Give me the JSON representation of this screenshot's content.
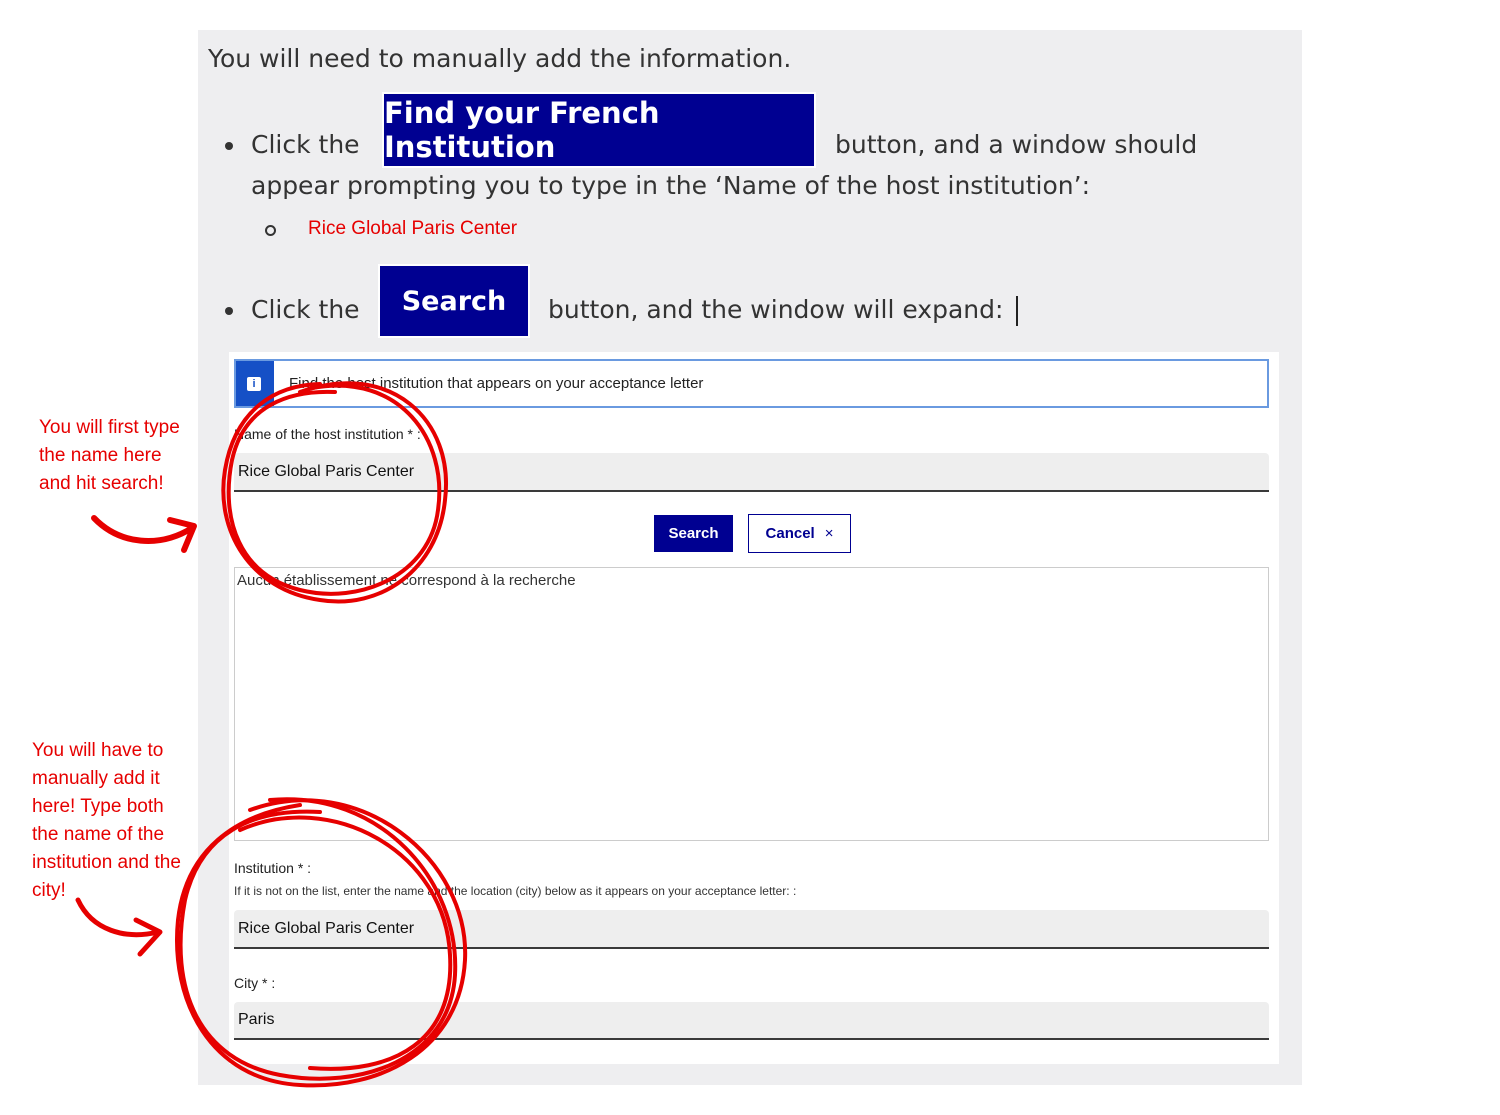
{
  "intro_text": "You will need to manually add the information.",
  "step1": {
    "prefix": "Click the",
    "button_label": "Find your French Institution",
    "suffix": "button, and a window should",
    "line2": "appear prompting you to type in the ‘Name of the host institution’:",
    "sub_item": "Rice Global Paris Center"
  },
  "step2": {
    "prefix": "Click the",
    "button_label": "Search",
    "suffix": "button, and the window will expand:"
  },
  "form": {
    "info_text": "Find the host institution that appears on your acceptance letter",
    "name_label": "Name of the host institution * :",
    "name_value": "Rice Global Paris Center",
    "search_label": "Search",
    "cancel_label": "Cancel",
    "cancel_icon": "×",
    "results_text": "Aucun établissement ne correspond à la recherche",
    "institution_label": "Institution * :",
    "institution_hint": "If it is not on the list, enter the name and the location (city) below as it appears on your acceptance letter: :",
    "institution_value": "Rice Global Paris Center",
    "city_label": "City * :",
    "city_value": "Paris"
  },
  "annotations": {
    "first": [
      "You will first type",
      "the name here",
      "and hit search!"
    ],
    "second": [
      "You will have to",
      "manually add it",
      "here! Type both",
      "the name of the",
      "institution and the",
      "city!"
    ]
  },
  "colors": {
    "brand_blue": "#000091",
    "annotation_red": "#e60000",
    "info_blue": "#1550c6"
  }
}
